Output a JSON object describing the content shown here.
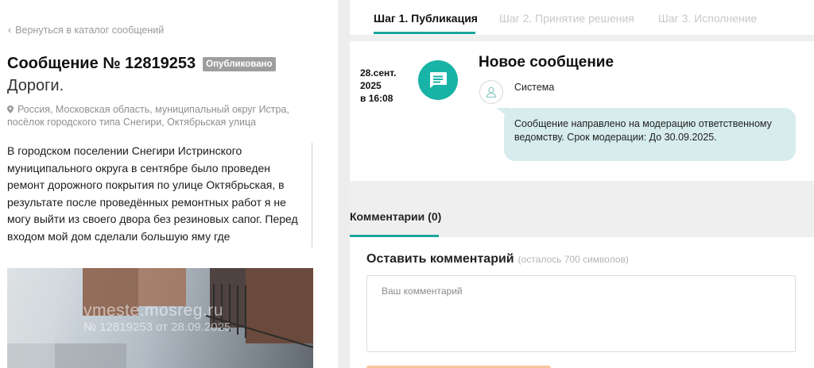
{
  "back_link": "Вернуться в каталог сообщений",
  "message": {
    "title": "Сообщение № 12819253",
    "status_badge": "Опубликовано",
    "category": "Дороги.",
    "address": "Россия, Московская область, муниципальный округ Истра, посёлок городского типа Снегири, Октябрьская улица",
    "description": "В городском поселении Снегири Истринского муниципального округа в сентябре было проведен ремонт дорожного покрытия по улице Октябрьская, в результате после проведённых ремонтных работ я не могу выйти из своего двора без резиновых сапог. Перед входом мой дом сделали большую яму где образовывается большое скопление воды прошу решить эту проблему покрытие"
  },
  "photo": {
    "watermark_site": "vmeste.mosreg.ru",
    "watermark_id": "№ 12819253 от 28.09.2025"
  },
  "steps": {
    "tabs": [
      {
        "label": "Шаг 1. Публикация",
        "active": true
      },
      {
        "label": "Шаг 2. Принятие решения",
        "active": false
      },
      {
        "label": "Шаг 3. Исполнение",
        "active": false
      }
    ]
  },
  "event": {
    "date_line1": "28.сент.",
    "date_line2": "2025",
    "date_line3": "в 16:08",
    "icon": "message-icon",
    "title": "Новое сообщение",
    "sender": "Система",
    "text": "Сообщение направлено на модерацию ответственному ведомству. Срок модерации: До 30.09.2025."
  },
  "comments": {
    "header": "Комментарии (0)",
    "form_title": "Оставить комментарий",
    "form_hint": "(осталось 700 символов)",
    "placeholder": "Ваш комментарий"
  },
  "colors": {
    "accent": "#1aa59c",
    "badge": "#9e9e9e",
    "bubble": "#d7ecec",
    "submit": "#f6c49b"
  }
}
